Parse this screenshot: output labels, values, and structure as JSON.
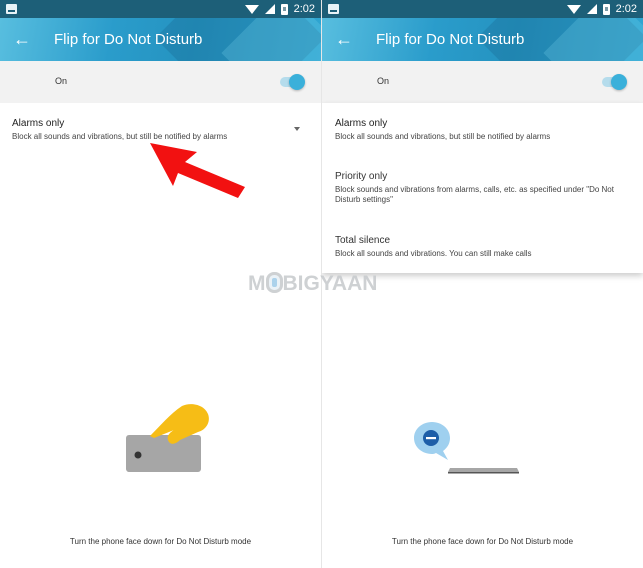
{
  "status_bar": {
    "time": "2:02",
    "icons": [
      "image-notification-icon",
      "wifi-icon",
      "cell-signal-icon",
      "battery-icon"
    ]
  },
  "screens": [
    {
      "app_bar": {
        "back_icon": "arrow-left-icon",
        "title": "Flip for Do Not Disturb"
      },
      "toggle": {
        "label": "On",
        "state": "on",
        "color": "#3ab0da"
      },
      "mode": {
        "title": "Alarms only",
        "description": "Block all sounds and vibrations, but still be notified by alarms",
        "caret_icon": "dropdown-caret-icon"
      },
      "annotation": {
        "type": "red-arrow",
        "color": "#ff0000"
      },
      "illustration": "hand-flipping-phone",
      "footer": "Turn the phone face down for Do Not Disturb mode"
    },
    {
      "app_bar": {
        "back_icon": "arrow-left-icon",
        "title": "Flip for Do Not Disturb"
      },
      "toggle": {
        "label": "On",
        "state": "on",
        "color": "#3ab0da"
      },
      "menu": {
        "items": [
          {
            "title": "Alarms only",
            "description": "Block all sounds and vibrations, but still be notified by alarms",
            "selected": true
          },
          {
            "title": "Priority only",
            "description": "Block sounds and vibrations from alarms, calls, etc. as specified under \"Do Not Disturb settings\"",
            "selected": false
          },
          {
            "title": "Total silence",
            "description": "Block all sounds and vibrations. You can still make calls",
            "selected": false
          }
        ]
      },
      "illustration": "phone-face-down-dnd",
      "footer": "Turn the phone face down for Do Not Disturb mode"
    }
  ],
  "watermark": {
    "before": "M",
    "after": "BIGYAAN"
  }
}
